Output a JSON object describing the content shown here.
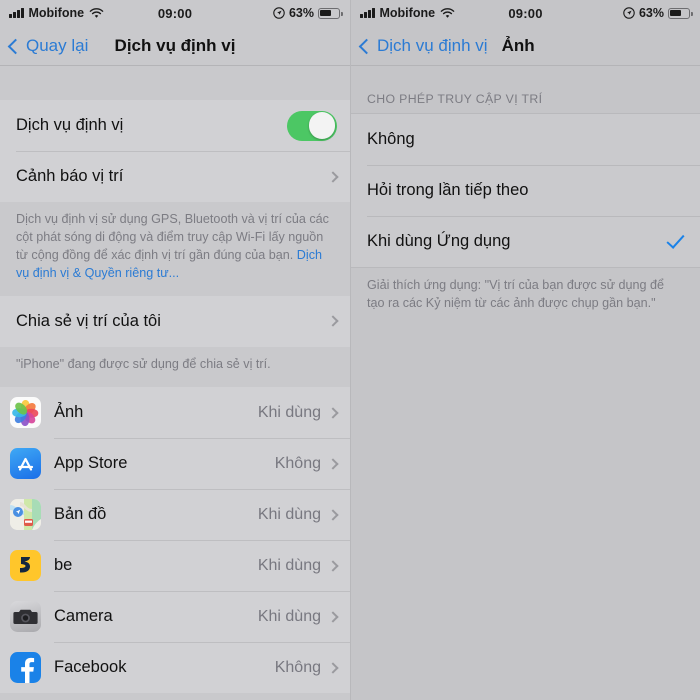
{
  "status_bar": {
    "carrier": "Mobifone",
    "time": "09:00",
    "battery_percent": "63%",
    "battery_level": 63,
    "icons": [
      "signal-bars-icon",
      "wifi-icon",
      "location-arrow-icon",
      "battery-icon"
    ]
  },
  "left_screen": {
    "nav": {
      "back_label": "Quay lại",
      "title": "Dịch vụ định vị"
    },
    "main_rows": [
      {
        "title": "Dịch vụ định vị",
        "type": "toggle",
        "on": true
      },
      {
        "title": "Cảnh báo vị trí",
        "type": "disclosure"
      }
    ],
    "footer_text": "Dịch vụ định vị sử dụng GPS, Bluetooth và vị trí của các cột phát sóng di động và điểm truy cập Wi-Fi lấy nguồn từ cộng đồng để xác định vị trí gần đúng của bạn. ",
    "footer_link": "Dịch vụ định vị & Quyền riêng tư...",
    "share_row": {
      "title": "Chia sẻ vị trí của tôi",
      "type": "disclosure"
    },
    "share_note": "\"iPhone\" đang được sử dụng để chia sẻ vị trí.",
    "apps": [
      {
        "name": "Ảnh",
        "value": "Khi dùng",
        "icon": "photos-icon"
      },
      {
        "name": "App Store",
        "value": "Không",
        "icon": "app-store-icon"
      },
      {
        "name": "Bản đồ",
        "value": "Khi dùng",
        "icon": "maps-icon"
      },
      {
        "name": "be",
        "value": "Khi dùng",
        "icon": "be-icon"
      },
      {
        "name": "Camera",
        "value": "Khi dùng",
        "icon": "camera-icon"
      },
      {
        "name": "Facebook",
        "value": "Không",
        "icon": "facebook-icon"
      }
    ]
  },
  "right_screen": {
    "nav": {
      "back_label": "Dịch vụ định vị",
      "title": "Ảnh"
    },
    "section_header": "CHO PHÉP TRUY CẬP VỊ TRÍ",
    "options": [
      {
        "label": "Không",
        "selected": false
      },
      {
        "label": "Hỏi trong lần tiếp theo",
        "selected": false
      },
      {
        "label": "Khi dùng Ứng dụng",
        "selected": true
      }
    ],
    "explanation": "Giải thích ứng dụng: \"Vị trí của bạn được sử dụng để tạo ra các Kỷ niệm từ các ảnh được chụp gần bạn.\""
  },
  "colors": {
    "accent_blue": "#1a82e8",
    "toggle_green": "#4cc764",
    "background": "#c9c9cc"
  }
}
